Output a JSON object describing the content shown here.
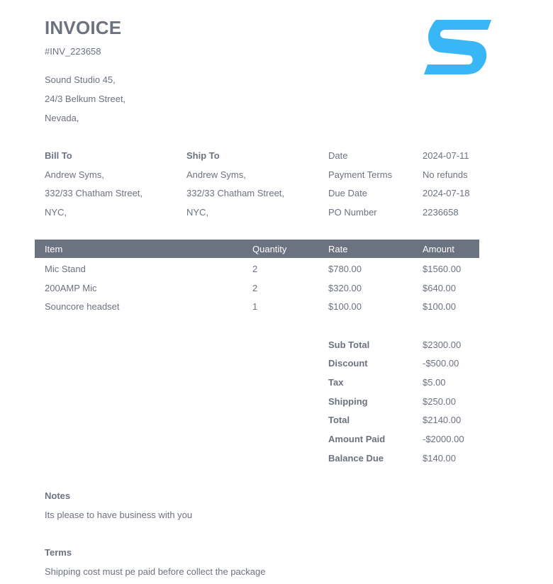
{
  "invoice": {
    "title": "INVOICE",
    "number": "#INV_223658",
    "logo_icon": "s-brand-logo",
    "brand_color": "#38b6f5",
    "from": [
      "Sound Studio 45,",
      "24/3 Belkum Street,",
      "Nevada,"
    ]
  },
  "bill_to": {
    "label": "Bill To",
    "lines": [
      "Andrew Syms,",
      "332/33 Chatham Street,",
      "NYC,"
    ]
  },
  "ship_to": {
    "label": "Ship To",
    "lines": [
      "Andrew Syms,",
      "332/33 Chatham Street,",
      "NYC,"
    ]
  },
  "meta": [
    {
      "label": "Date",
      "value": "2024-07-11"
    },
    {
      "label": "Payment Terms",
      "value": "No refunds"
    },
    {
      "label": "Due Date",
      "value": "2024-07-18"
    },
    {
      "label": "PO Number",
      "value": "2236658"
    }
  ],
  "table": {
    "header_color": "#6b7280",
    "headers": [
      "Item",
      "Quantity",
      "Rate",
      "Amount"
    ],
    "rows": [
      [
        "Mic Stand",
        "2",
        "$780.00",
        "$1560.00"
      ],
      [
        "200AMP Mic",
        "2",
        "$320.00",
        "$640.00"
      ],
      [
        "Souncore headset",
        "1",
        "$100.00",
        "$100.00"
      ]
    ]
  },
  "totals": [
    {
      "label": "Sub Total",
      "value": "$2300.00"
    },
    {
      "label": "Discount",
      "value": "-$500.00"
    },
    {
      "label": "Tax",
      "value": "$5.00"
    },
    {
      "label": "Shipping",
      "value": "$250.00"
    },
    {
      "label": "Total",
      "value": "$2140.00"
    },
    {
      "label": "Amount Paid",
      "value": "-$2000.00"
    },
    {
      "label": "Balance Due",
      "value": "$140.00"
    }
  ],
  "notes": {
    "label": "Notes",
    "text": "Its please to have business with you"
  },
  "terms": {
    "label": "Terms",
    "text": "Shipping cost must pe paid before collect the package"
  }
}
